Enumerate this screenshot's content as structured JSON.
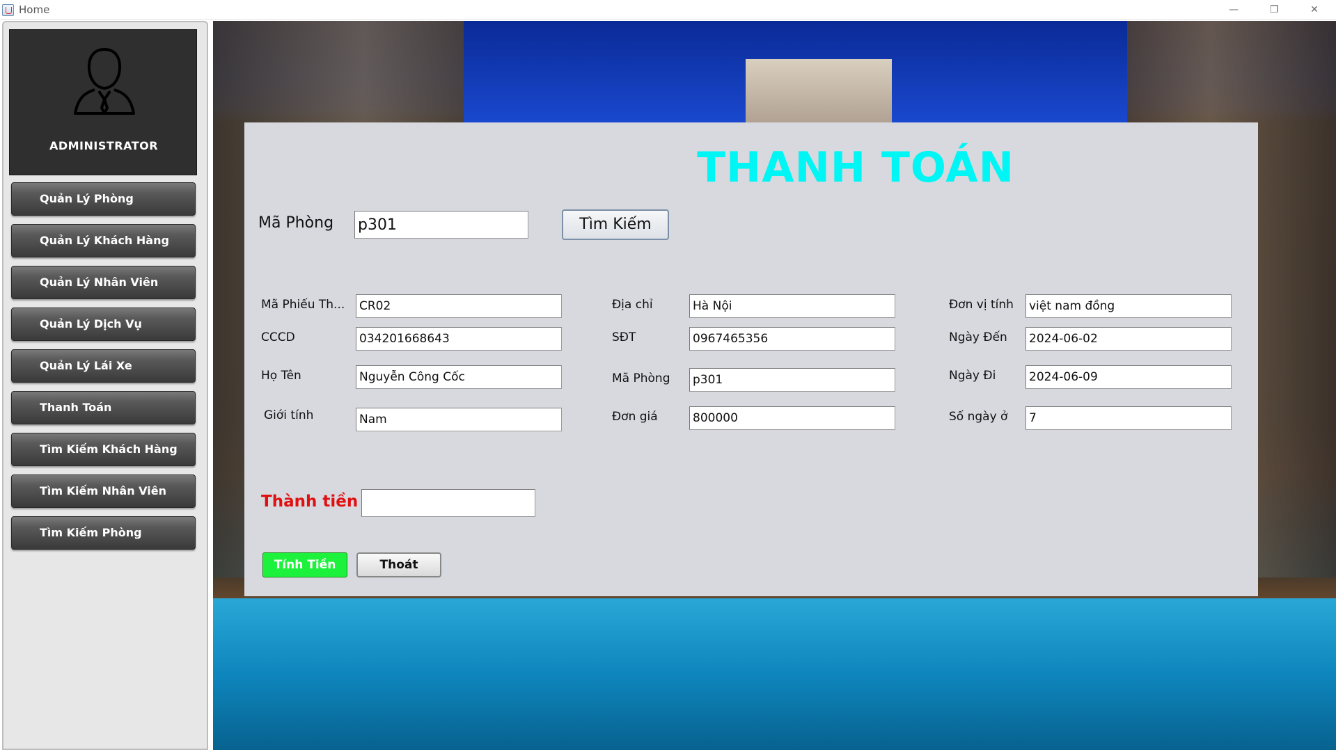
{
  "window": {
    "title": "Home",
    "minimize_glyph": "—",
    "restore_glyph": "❐",
    "close_glyph": "✕"
  },
  "sidebar": {
    "profile_label": "ADMINISTRATOR",
    "items": [
      {
        "label": "Quản Lý Phòng"
      },
      {
        "label": "Quản Lý Khách Hàng"
      },
      {
        "label": "Quản Lý Nhân Viên"
      },
      {
        "label": "Quản Lý Dịch Vụ"
      },
      {
        "label": "Quản Lý Lái Xe"
      },
      {
        "label": "Thanh Toán"
      },
      {
        "label": "Tìm Kiếm Khách Hàng"
      },
      {
        "label": "Tìm Kiếm Nhân Viên"
      },
      {
        "label": "Tìm Kiếm Phòng"
      }
    ]
  },
  "panel": {
    "title": "THANH TOÁN",
    "search": {
      "label": "Mã Phòng",
      "value": "p301",
      "button": "Tìm Kiếm"
    },
    "fields": {
      "receipt_id": {
        "label": "Mã Phiếu Th...",
        "value": "CR02"
      },
      "cccd": {
        "label": "CCCD",
        "value": "034201668643"
      },
      "full_name": {
        "label": "Họ Tên",
        "value": "Nguyễn Công Cốc"
      },
      "gender": {
        "label": "Giới tính",
        "value": "Nam"
      },
      "address": {
        "label": "Địa chỉ",
        "value": "Hà Nội"
      },
      "phone": {
        "label": "SĐT",
        "value": "0967465356"
      },
      "room_id": {
        "label": "Mã Phòng",
        "value": "p301"
      },
      "unit_price": {
        "label": "Đơn giá",
        "value": "800000"
      },
      "currency": {
        "label": "Đơn vị tính",
        "value": "việt nam đồng"
      },
      "arrival_date": {
        "label": "Ngày Đến",
        "value": "2024-06-02"
      },
      "departure_date": {
        "label": "Ngày Đi",
        "value": "2024-06-09"
      },
      "nights": {
        "label": "Số ngày ở",
        "value": "7"
      }
    },
    "total": {
      "label": "Thành tiền",
      "value": ""
    },
    "buttons": {
      "calculate": "Tính Tiền",
      "exit": "Thoát"
    }
  },
  "colors": {
    "title_accent": "#00f5f5",
    "total_label": "#e01010",
    "calc_button": "#1cf23c",
    "panel_bg": "#d7d9df",
    "sidebar_button": "#4a4a4a"
  },
  "icons": {
    "profile": "user-silhouette-icon",
    "app": "java-app-icon"
  }
}
